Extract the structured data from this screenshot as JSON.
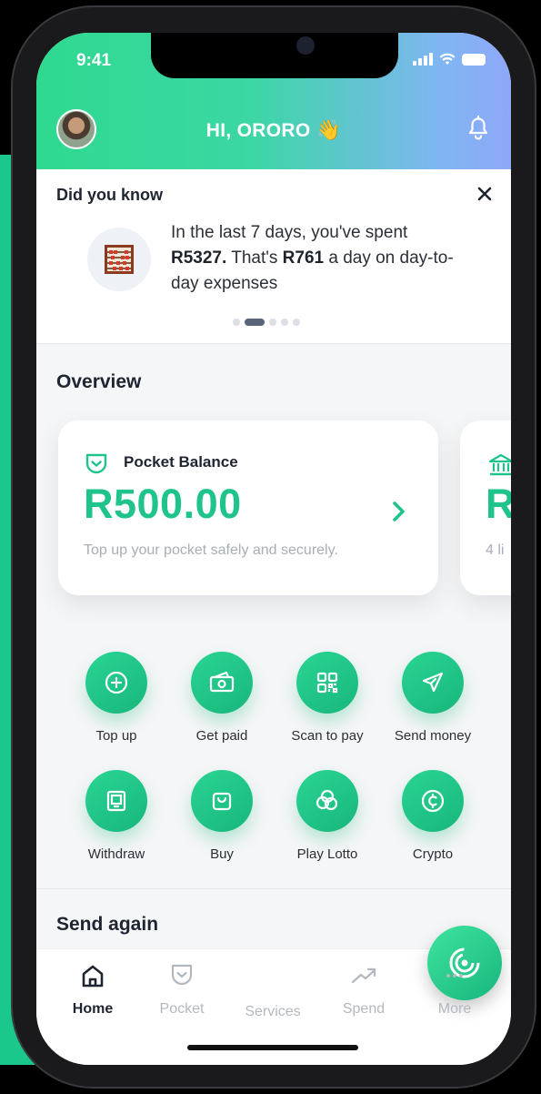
{
  "status_bar": {
    "time": "9:41"
  },
  "header": {
    "greeting": "HI, ORORO",
    "wave_emoji": "👋"
  },
  "did_you_know": {
    "title": "Did you know",
    "text_1": "In the last 7 days, you've spent ",
    "amount_spent": "R5327.",
    "text_2": " That's ",
    "daily_amount": "R761",
    "text_3": " a day on day-to-day expenses",
    "carousel_active_index": 1,
    "carousel_count": 5
  },
  "overview": {
    "title": "Overview",
    "pocket_card": {
      "label": "Pocket Balance",
      "balance": "R500.00",
      "subtitle": "Top up your pocket safely and securely."
    },
    "second_card": {
      "balance_partial": "R",
      "subtitle_partial": "4 li"
    }
  },
  "actions": [
    {
      "label": "Top up",
      "icon": "plus-circle-icon"
    },
    {
      "label": "Get paid",
      "icon": "cash-icon"
    },
    {
      "label": "Scan to pay",
      "icon": "qr-code-icon"
    },
    {
      "label": "Send money",
      "icon": "paper-plane-icon"
    },
    {
      "label": "Withdraw",
      "icon": "atm-icon"
    },
    {
      "label": "Buy",
      "icon": "shopping-bag-icon"
    },
    {
      "label": "Play Lotto",
      "icon": "lotto-balls-icon"
    },
    {
      "label": "Crypto",
      "icon": "crypto-coin-icon"
    }
  ],
  "send_again": {
    "title": "Send again"
  },
  "tabbar": {
    "home": "Home",
    "pocket": "Pocket",
    "services": "Services",
    "spend": "Spend",
    "more": "More",
    "active": "home"
  },
  "colors": {
    "brand_green": "#1fc38c",
    "header_gradient_end": "#8fa7f8"
  }
}
